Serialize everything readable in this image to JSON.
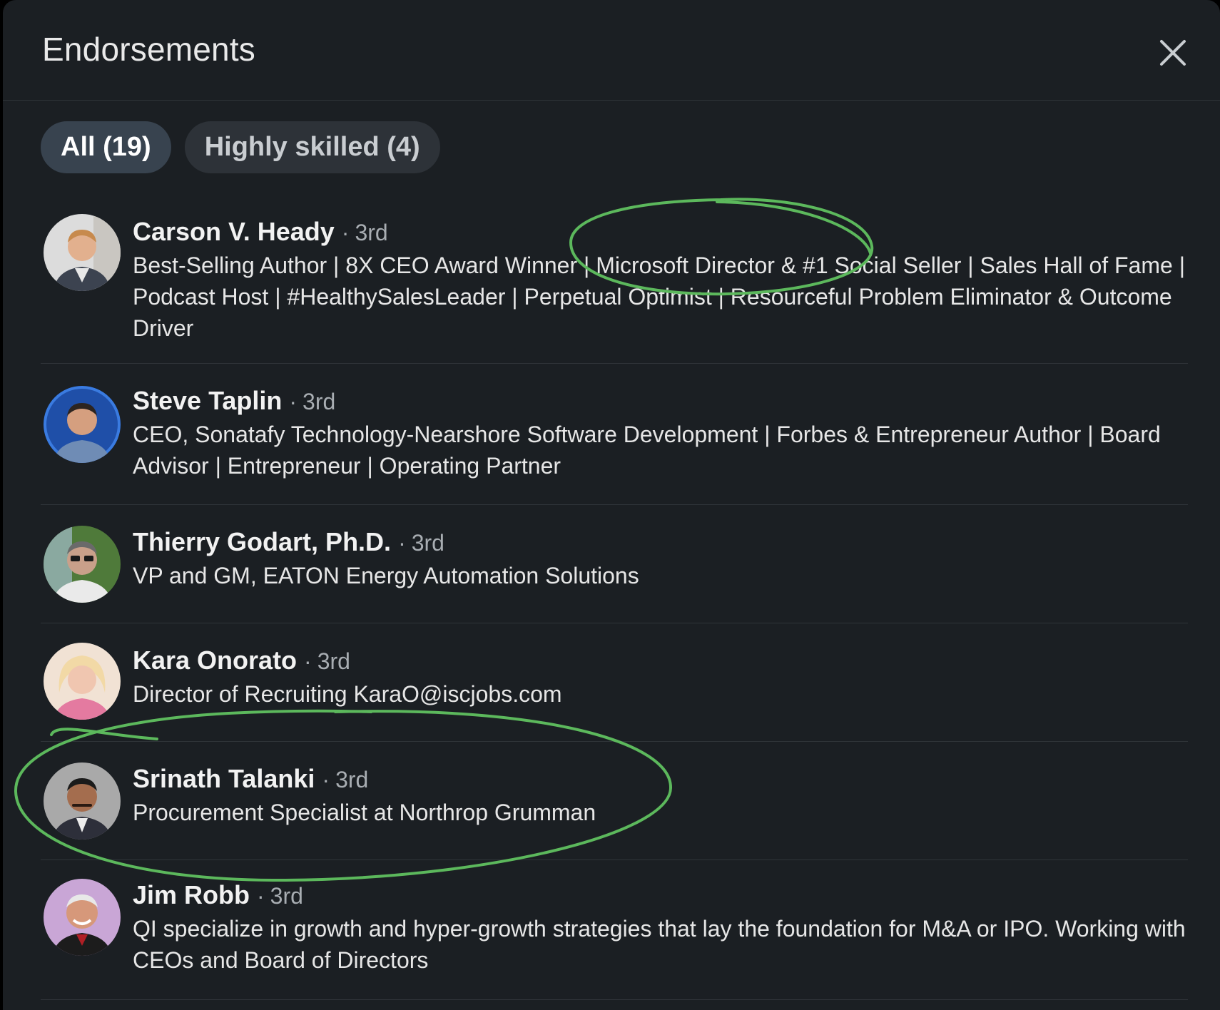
{
  "dialog": {
    "title": "Endorsements",
    "close_label": "Dismiss"
  },
  "filters": [
    {
      "label": "All (19)",
      "active": true
    },
    {
      "label": "Highly skilled (4)",
      "active": false
    }
  ],
  "endorsers": [
    {
      "name": "Carson V. Heady",
      "degree": "3rd",
      "headline": "Best-Selling Author | 8X CEO Award Winner | Microsoft Director & #1 Social Seller | Sales Hall of Fame | Podcast Host | #HealthySalesLeader | Perpetual Optimist | Resourceful Problem Eliminator & Outcome Driver"
    },
    {
      "name": "Steve Taplin",
      "degree": "3rd",
      "headline": "CEO, Sonatafy Technology-Nearshore Software Development | Forbes & Entrepreneur Author | Board Advisor | Entrepreneur | Operating Partner"
    },
    {
      "name": "Thierry Godart, Ph.D.",
      "degree": "3rd",
      "headline": "VP and GM, EATON Energy Automation Solutions"
    },
    {
      "name": "Kara Onorato",
      "degree": "3rd",
      "headline": "Director of Recruiting KaraO@iscjobs.com"
    },
    {
      "name": "Srinath Talanki",
      "degree": "3rd",
      "headline": "Procurement Specialist at Northrop Grumman"
    },
    {
      "name": "Jim Robb",
      "degree": "3rd",
      "headline": "QI specialize in growth and hyper-growth strategies that lay the foundation for M&A or IPO. Working with CEOs and Board of Directors"
    }
  ],
  "colors": {
    "background": "#1b1f23",
    "annotation": "#5cb85c"
  }
}
